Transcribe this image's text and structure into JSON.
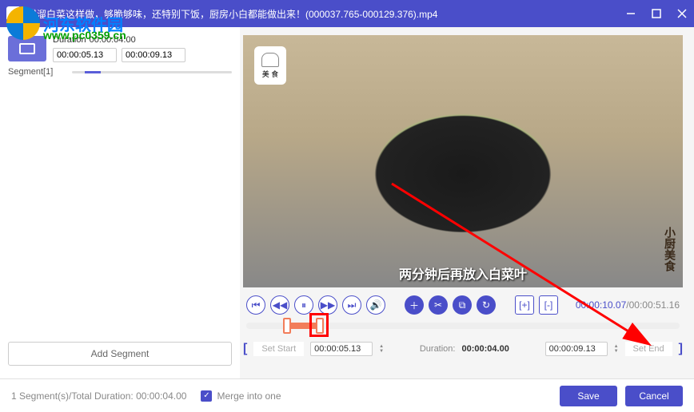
{
  "watermark": {
    "text": "河东软件园",
    "url": "www.pc0359.cn"
  },
  "titlebar": {
    "title": "醋溜白菜这样做，够脆够味，还特别下饭，厨房小白都能做出来！(000037.765-000129.376).mp4"
  },
  "segment": {
    "duration_label": "Duration",
    "duration_value": "00:00:04.00",
    "start_time": "00:00:05.13",
    "end_time": "00:00:09.13",
    "label": "Segment[1]"
  },
  "add_segment_label": "Add Segment",
  "video": {
    "chef_text": "美 食",
    "subtitle": "两分钟后再放入白菜叶",
    "side_text": "小厨美食"
  },
  "controls": {
    "current_time": "00:00:10.07",
    "total_time": "00:00:51.16"
  },
  "range": {
    "set_start_label": "Set Start",
    "start_value": "00:00:05.13",
    "duration_label": "Duration:",
    "duration_value": "00:00:04.00",
    "end_value": "00:00:09.13",
    "set_end_label": "Set End"
  },
  "footer": {
    "status": "1 Segment(s)/Total Duration: 00:00:04.00",
    "merge_label": "Merge into one",
    "save_label": "Save",
    "cancel_label": "Cancel"
  }
}
